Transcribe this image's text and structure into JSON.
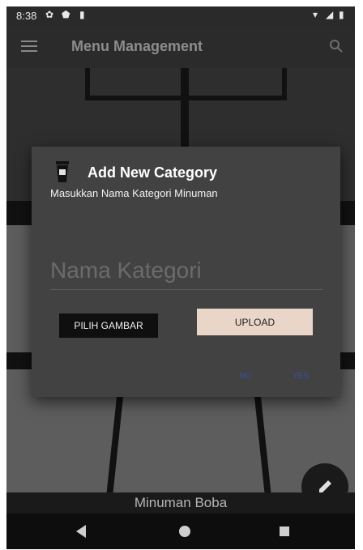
{
  "status_bar": {
    "time": "8:38"
  },
  "app_bar": {
    "title": "Menu Management"
  },
  "content": {
    "caption": "Minuman Boba"
  },
  "dialog": {
    "title": "Add New Category",
    "subtitle": "Masukkan Nama Kategori Minuman",
    "name_placeholder": "Nama Kategori",
    "name_value": "",
    "choose_image_label": "PILIH GAMBAR",
    "upload_label": "UPLOAD",
    "cancel_label": "NO",
    "confirm_label": "YES"
  },
  "colors": {
    "dialog_bg": "#424242",
    "upload_button": "#e9d6c9",
    "choose_button": "#0f0f0f",
    "action_text": "#3a4fa0"
  },
  "icons": [
    "menu-icon",
    "search-icon",
    "settings-icon",
    "shield-icon",
    "sd-card-icon",
    "wifi-icon",
    "signal-icon",
    "battery-icon",
    "boba-cup-icon",
    "edit-pencil-icon",
    "back-icon",
    "home-icon",
    "recents-icon"
  ]
}
